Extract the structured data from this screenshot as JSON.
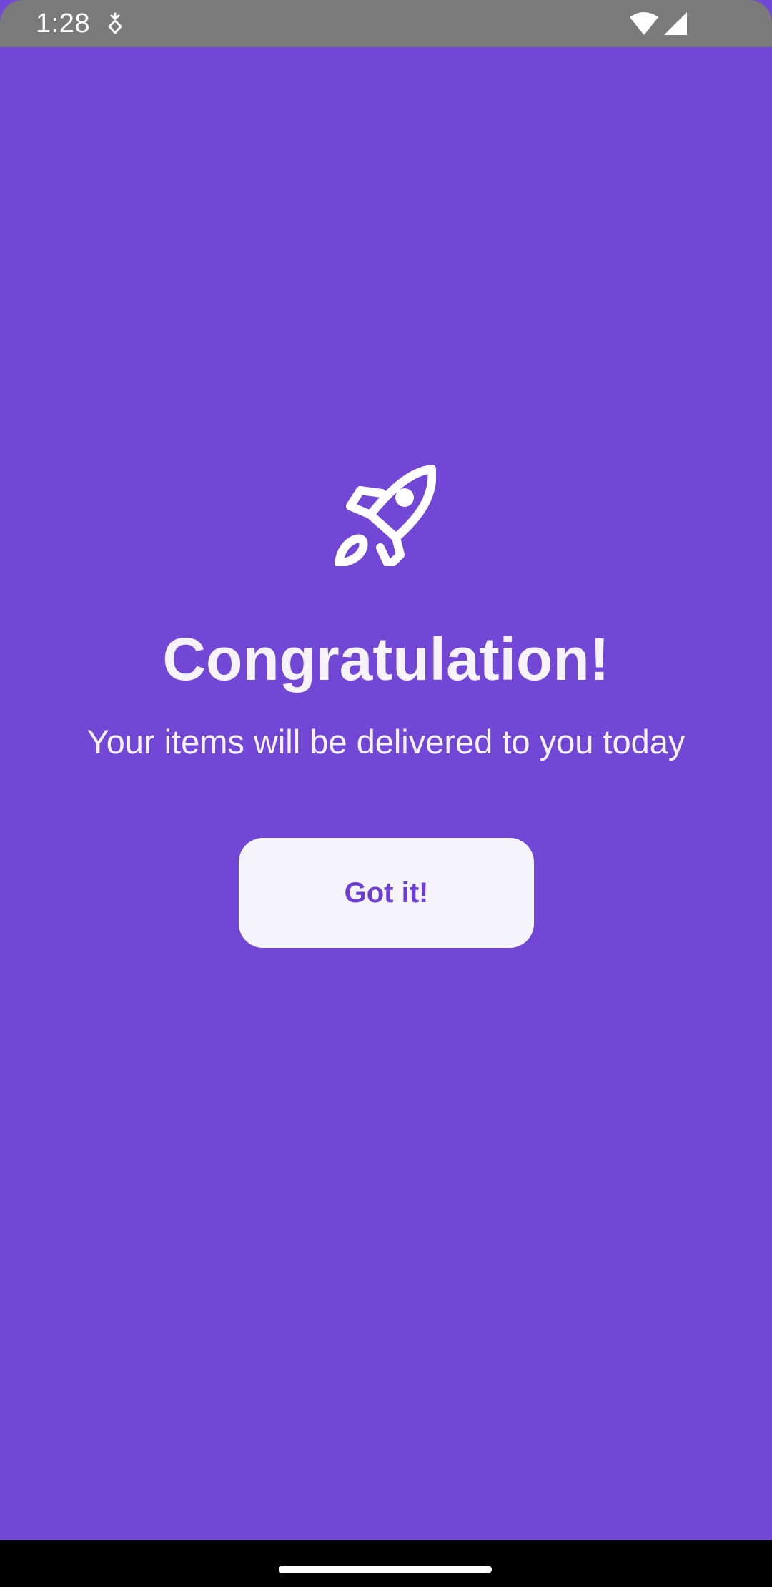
{
  "status_bar": {
    "time": "1:28",
    "icons": [
      "debug-icon",
      "wifi-icon",
      "signal-icon"
    ],
    "background": "#7a7a7a"
  },
  "main": {
    "icon": "rocket-icon",
    "title": "Congratulation!",
    "subtitle": "Your items will be delivered to you today",
    "button_label": "Got it!",
    "background": "#7247d6",
    "text_color": "#f6f3fb",
    "button_background": "#f6f4fb",
    "button_text_color": "#6d3fd0"
  },
  "nav_bar": {
    "background": "#000000"
  }
}
